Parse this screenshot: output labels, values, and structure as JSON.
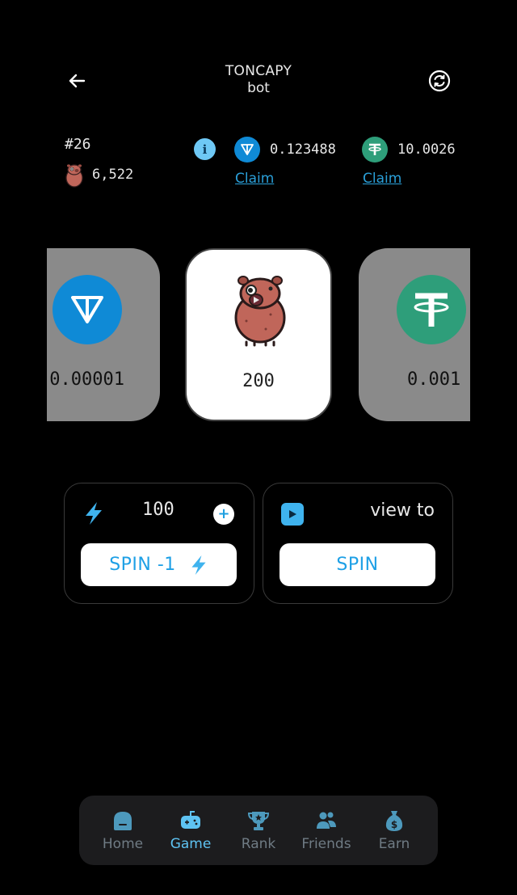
{
  "header": {
    "title": "TONCAPY",
    "subtitle": "bot",
    "back_icon": "arrow-left-icon",
    "refresh_icon": "refresh-icon"
  },
  "stats": {
    "rank": "#26",
    "score": "6,522"
  },
  "balances": {
    "ton": {
      "value": "0.123488",
      "claim_label": "Claim"
    },
    "usdt": {
      "value": "10.0026",
      "claim_label": "Claim"
    }
  },
  "carousel": {
    "cards": [
      {
        "id": "ton",
        "amount": "0.00001"
      },
      {
        "id": "capy",
        "amount": "200"
      },
      {
        "id": "usdt",
        "amount": "0.001"
      }
    ]
  },
  "energy": {
    "value": "100",
    "spin_label": "SPIN -1"
  },
  "ad": {
    "label": "view to",
    "spin_label": "SPIN"
  },
  "tabs": [
    {
      "label": "Home",
      "active": false
    },
    {
      "label": "Game",
      "active": true
    },
    {
      "label": "Rank",
      "active": false
    },
    {
      "label": "Friends",
      "active": false
    },
    {
      "label": "Earn",
      "active": false
    }
  ],
  "colors": {
    "accent": "#1ea0e6",
    "tab_active": "#5ec3f2",
    "tab_inactive": "#6f7b84",
    "ton": "#0f8ad6",
    "usdt": "#2e9e7a",
    "background": "#000000"
  }
}
